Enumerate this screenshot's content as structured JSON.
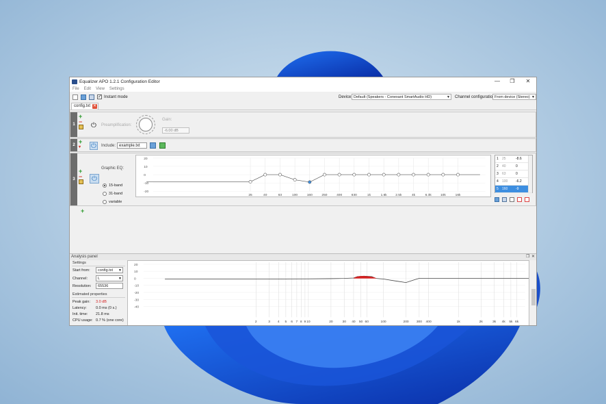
{
  "window": {
    "title": "Equalizer APO 1.2.1 Configuration Editor",
    "controls": {
      "minimize": "—",
      "maximize": "❐",
      "close": "✕"
    }
  },
  "menu": [
    "File",
    "Edit",
    "View",
    "Settings"
  ],
  "toolbar": {
    "instant_mode_label": "Instant mode",
    "instant_mode_checked": true,
    "device_label": "Device:",
    "device_value": "Default (Speakers - Conexant SmartAudio HD)",
    "channel_label": "Channel configuration:",
    "channel_value": "From device (Stereo)"
  },
  "tab": {
    "label": "config.txt",
    "close": "✕"
  },
  "filters": {
    "preamp": {
      "number": "1",
      "label": "Preamplification:",
      "gain_label": "Gain:",
      "gain_value": "-6.00 dB"
    },
    "include": {
      "number": "2",
      "label": "Include:",
      "value": "example.txt"
    },
    "graphic_eq": {
      "number": "3",
      "label": "Graphic EQ:",
      "options": [
        "15-band",
        "31-band",
        "variable"
      ],
      "selected": "15-band",
      "y_ticks": [
        "20",
        "10",
        "0",
        "-10",
        "-20"
      ],
      "x_labels": [
        "25",
        "40",
        "63",
        "100",
        "160",
        "250",
        "400",
        "630",
        "1k",
        "1.6k",
        "2.5k",
        "4k",
        "6.3k",
        "10k",
        "16k"
      ],
      "gains": [
        -8.6,
        0,
        0,
        -6.2,
        -9,
        0,
        0,
        0,
        0,
        0,
        0,
        0,
        0,
        0,
        0
      ],
      "table": [
        {
          "n": "1",
          "f": "25",
          "g": "-8.6"
        },
        {
          "n": "2",
          "f": "40",
          "g": "0"
        },
        {
          "n": "3",
          "f": "63",
          "g": "0"
        },
        {
          "n": "4",
          "f": "100",
          "g": "-6.2"
        },
        {
          "n": "5",
          "f": "160",
          "g": "-9"
        }
      ],
      "selected_row": 4
    }
  },
  "analysis": {
    "title": "Analysis panel",
    "settings_label": "Settings",
    "start_from_label": "Start from:",
    "start_from_value": "config.txt",
    "channel_label": "Channel:",
    "channel_value": "L",
    "resolution_label": "Resolution:",
    "resolution_value": "65536",
    "estimated_label": "Estimated properties",
    "peak_gain_label": "Peak gain:",
    "peak_gain_value": "3.0 dB",
    "latency_label": "Latency:",
    "latency_value": "0.0 ms (0 s.)",
    "init_label": "Init. time:",
    "init_value": "21.8 ms",
    "cpu_label": "CPU usage:",
    "cpu_value": "0.7 % (one core)",
    "y_ticks": [
      "20",
      "10",
      "0",
      "-10",
      "-20",
      "-30",
      "-40"
    ],
    "x_labels": [
      "2",
      "3",
      "4",
      "5",
      "6",
      "7",
      "8",
      "9",
      "10",
      "20",
      "30",
      "40",
      "50",
      "60",
      "100",
      "200",
      "300",
      "400",
      "1k",
      "2k",
      "3k",
      "4k",
      "5k",
      "6k",
      "10k",
      "20k"
    ],
    "accent": "#d42020"
  }
}
